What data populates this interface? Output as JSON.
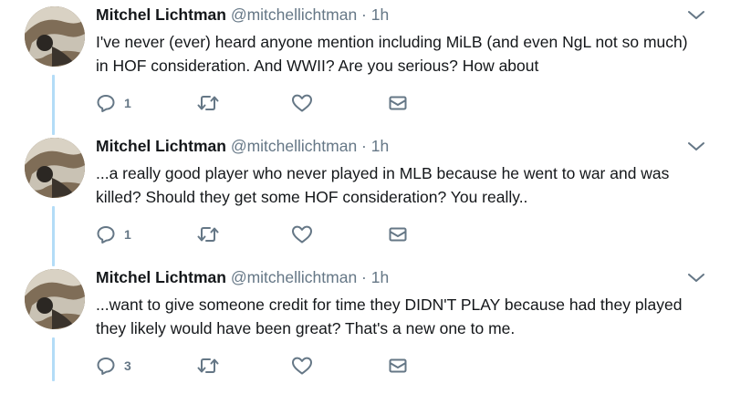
{
  "tweets": [
    {
      "author_name": "Mitchel Lichtman",
      "handle": "@mitchellichtman",
      "separator": "·",
      "time": "1h",
      "text": "I've never (ever) heard anyone mention including MiLB (and even NgL not so much) in HOF consideration. And WWII? Are you serious? How about",
      "reply_count": "1"
    },
    {
      "author_name": "Mitchel Lichtman",
      "handle": "@mitchellichtman",
      "separator": "·",
      "time": "1h",
      "text": "...a really good player who never played in MLB because he went to war and was killed? Should they get some HOF consideration? You really..",
      "reply_count": "1"
    },
    {
      "author_name": "Mitchel Lichtman",
      "handle": "@mitchellichtman",
      "separator": "·",
      "time": "1h",
      "text": "...want to give someone credit for time they DIDN'T PLAY because had they played they likely would have been great? That's a new one to me.",
      "reply_count": "3"
    }
  ],
  "icons": {
    "reply": "reply-icon",
    "retweet": "retweet-icon",
    "like": "heart-icon",
    "message": "envelope-icon",
    "more": "chevron-down-icon"
  },
  "colors": {
    "thread_line": "#b3dcf7",
    "icon": "#657786",
    "text": "#14171a"
  }
}
